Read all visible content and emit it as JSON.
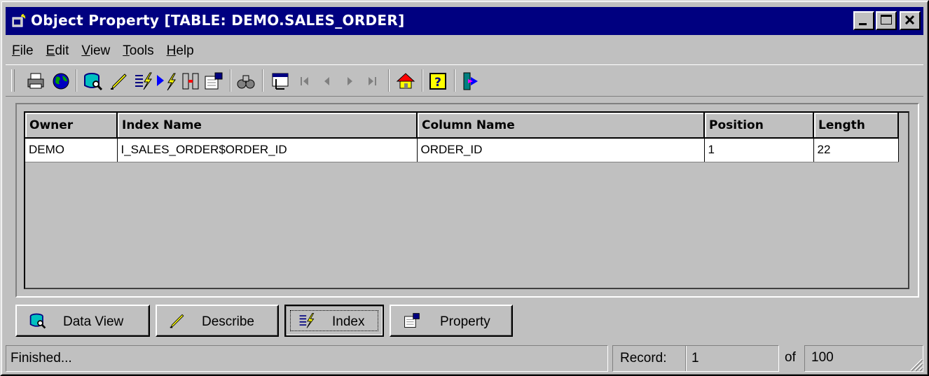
{
  "window": {
    "title": "Object Property  [TABLE:  DEMO.SALES_ORDER]",
    "controls": {
      "minimize": "minimize",
      "maximize": "maximize",
      "close": "close"
    }
  },
  "menu": {
    "items": [
      {
        "label": "File"
      },
      {
        "label": "Edit"
      },
      {
        "label": "View"
      },
      {
        "label": "Tools"
      },
      {
        "label": "Help"
      }
    ]
  },
  "toolbar": {
    "icons": [
      "printer-icon",
      "globe-icon",
      "data-view-icon",
      "describe-icon",
      "index-icon",
      "run-index-icon",
      "columns-icon",
      "property-icon",
      "find-icon",
      "record-icon",
      "first-record-icon",
      "previous-record-icon",
      "next-record-icon",
      "last-record-icon",
      "home-icon",
      "help-icon",
      "exit-icon"
    ]
  },
  "grid": {
    "columns": [
      "Owner",
      "Index Name",
      "Column Name",
      "Position",
      "Length"
    ],
    "rows": [
      [
        "DEMO",
        "I_SALES_ORDER$ORDER_ID",
        "ORDER_ID",
        "1",
        "22"
      ]
    ]
  },
  "tabs": [
    {
      "label": "Data View",
      "icon": "data-view-icon"
    },
    {
      "label": "Describe",
      "icon": "describe-icon"
    },
    {
      "label": "Index",
      "icon": "index-icon",
      "active": true
    },
    {
      "label": "Property",
      "icon": "property-icon"
    }
  ],
  "status": {
    "message": "Finished...",
    "record_label": "Record:",
    "record_value": "1",
    "of_label": "of",
    "total": "100"
  },
  "colors": {
    "titlebar": "#000080",
    "face": "#c0c0c0",
    "grid_background": "#ffffff"
  }
}
